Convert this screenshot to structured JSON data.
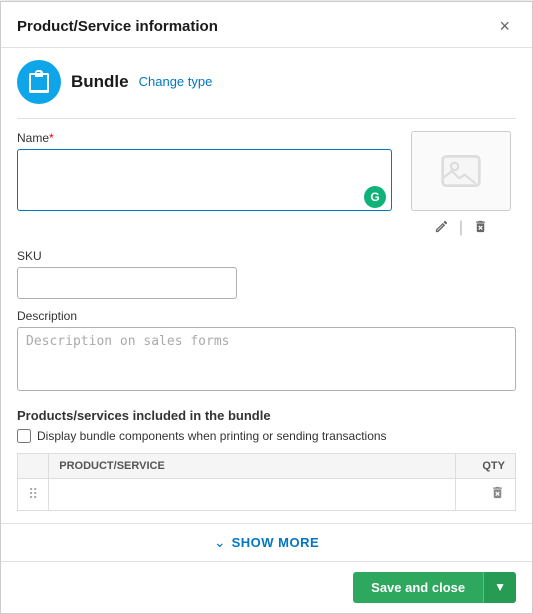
{
  "modal": {
    "title": "Product/Service information",
    "close_label": "×"
  },
  "product_type": {
    "icon": "👕",
    "label": "Bundle",
    "change_link": "Change type"
  },
  "name_field": {
    "label": "Name",
    "required": true,
    "value": "",
    "placeholder": ""
  },
  "grammarly": {
    "label": "G"
  },
  "sku_field": {
    "label": "SKU",
    "value": "",
    "placeholder": ""
  },
  "description_field": {
    "label": "Description",
    "placeholder": "Description on sales forms"
  },
  "bundle_section": {
    "title": "Products/services included in the bundle",
    "checkbox_label": "Display bundle components when printing or sending transactions",
    "table": {
      "columns": [
        {
          "key": "drag",
          "label": ""
        },
        {
          "key": "product",
          "label": "PRODUCT/SERVICE"
        },
        {
          "key": "qty",
          "label": "QTY"
        }
      ],
      "rows": []
    }
  },
  "show_more": {
    "label": "SHOW MORE"
  },
  "footer": {
    "save_label": "Save and close",
    "dropdown_label": "▼"
  }
}
